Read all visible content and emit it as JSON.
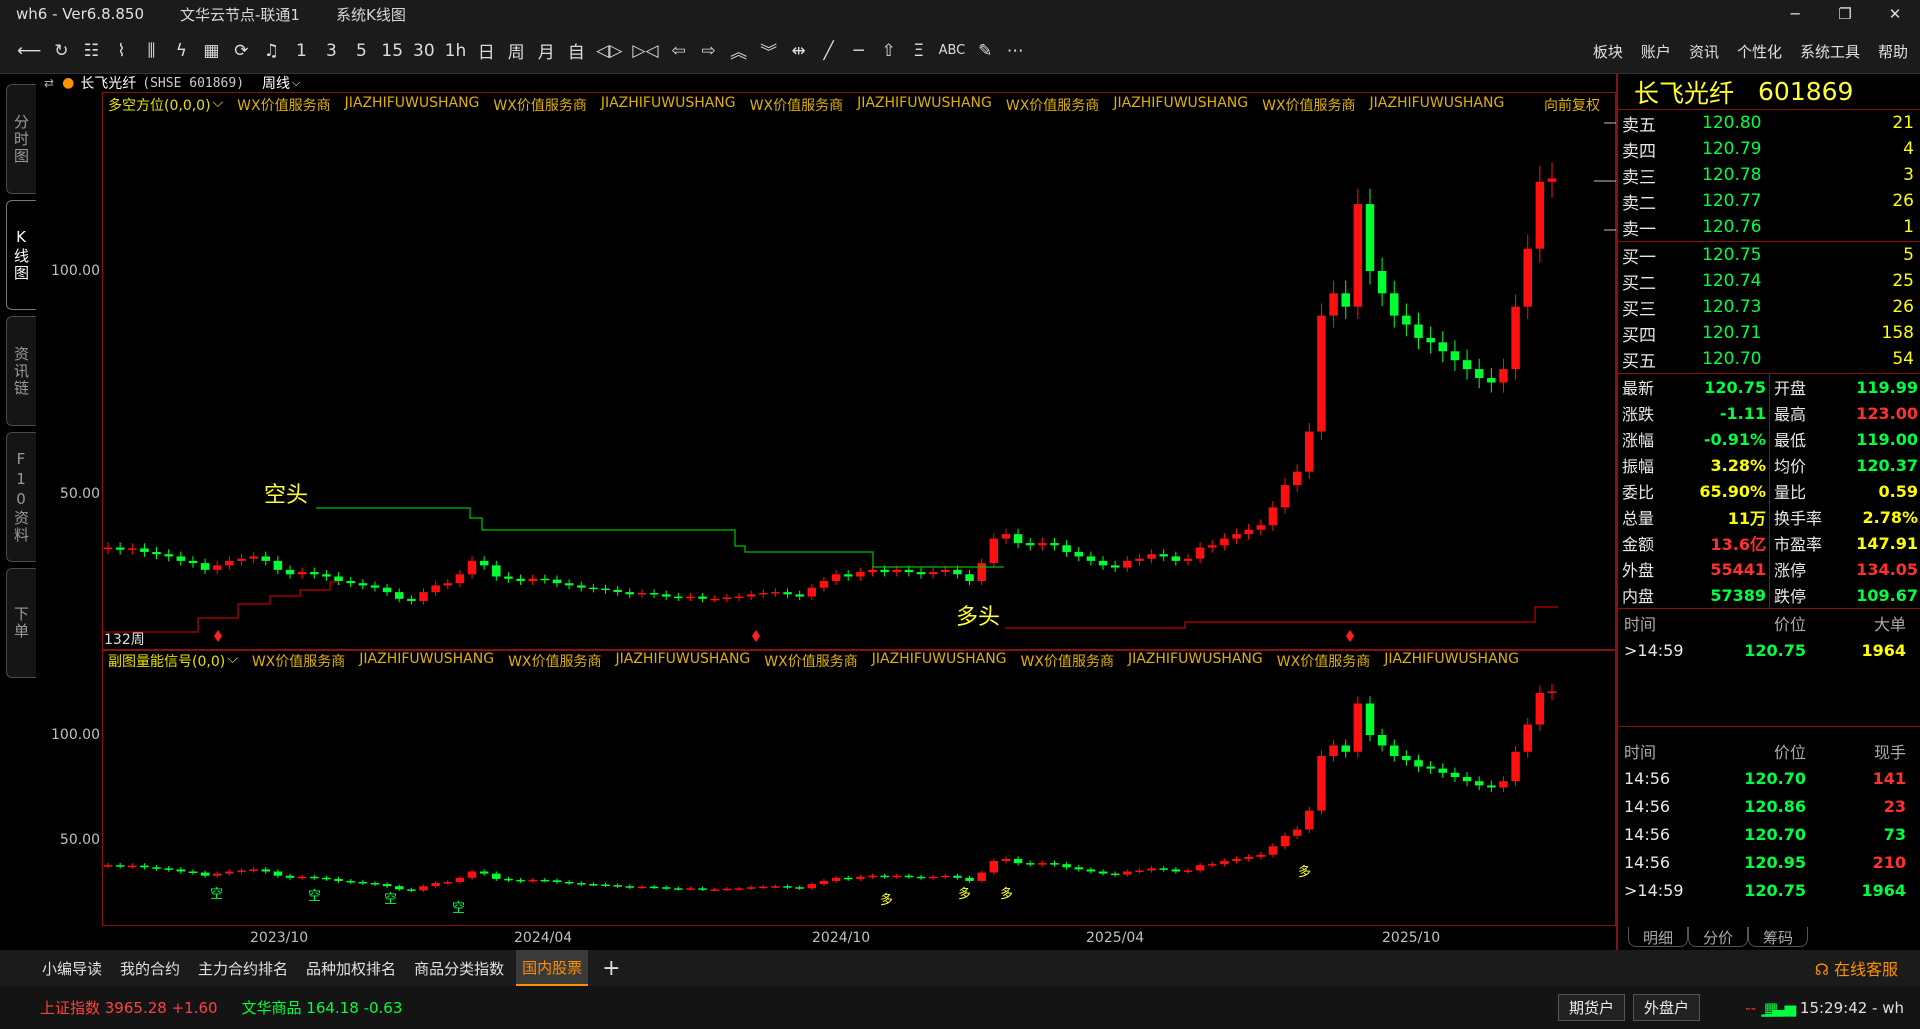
{
  "window": {
    "title": "wh6 - Ver6.8.850",
    "server": "文华云节点-联通1",
    "view": "系统K线图",
    "controls": [
      "─",
      "❐",
      "✕"
    ]
  },
  "toolbar": {
    "periods": [
      "1",
      "3",
      "5",
      "15",
      "30",
      "1h",
      "日",
      "周",
      "月",
      "自"
    ],
    "menus": [
      "板块",
      "账户",
      "资讯",
      "个性化",
      "系统工具",
      "帮助"
    ]
  },
  "left_tabs": [
    "分时图",
    "K线图",
    "资讯链",
    "F10资料",
    "下单"
  ],
  "stock": {
    "name": "长飞光纤",
    "market_code": "(SHSE 601869)",
    "period": "周线",
    "full_code": "601869"
  },
  "main_panel": {
    "indicator": "多空方位(0,0,0)",
    "watermark_a": "WX价值服务商",
    "watermark_b": "JIAZHIFUWUSHANG",
    "adjust": "向前复权",
    "ma_label": "132周",
    "bear_label": "空头",
    "bull_label": "多头",
    "y_ticks": [
      "100.00",
      "50.00"
    ]
  },
  "sub_panel": {
    "indicator": "副图量能信号(0,0)",
    "y_ticks": [
      "100.00",
      "50.00"
    ],
    "kong_label": "空",
    "duo_label": "多"
  },
  "x_axis": [
    "2023/10",
    "2024/04",
    "2024/10",
    "2025/04",
    "2025/10"
  ],
  "orderbook": {
    "asks": [
      {
        "label": "卖五",
        "price": "120.80",
        "vol": "21"
      },
      {
        "label": "卖四",
        "price": "120.79",
        "vol": "4"
      },
      {
        "label": "卖三",
        "price": "120.78",
        "vol": "3"
      },
      {
        "label": "卖二",
        "price": "120.77",
        "vol": "26"
      },
      {
        "label": "卖一",
        "price": "120.76",
        "vol": "1"
      }
    ],
    "bids": [
      {
        "label": "买一",
        "price": "120.75",
        "vol": "5"
      },
      {
        "label": "买二",
        "price": "120.74",
        "vol": "25"
      },
      {
        "label": "买三",
        "price": "120.73",
        "vol": "26"
      },
      {
        "label": "买四",
        "price": "120.71",
        "vol": "158"
      },
      {
        "label": "买五",
        "price": "120.70",
        "vol": "54"
      }
    ]
  },
  "stats": [
    {
      "k": "最新",
      "v": "120.75",
      "c": "#00ff40",
      "k2": "开盘",
      "v2": "119.99",
      "c2": "#00ff40"
    },
    {
      "k": "涨跌",
      "v": "-1.11",
      "c": "#00ff40",
      "k2": "最高",
      "v2": "123.00",
      "c2": "#ff3030"
    },
    {
      "k": "涨幅",
      "v": "-0.91%",
      "c": "#00ff40",
      "k2": "最低",
      "v2": "119.00",
      "c2": "#00ff40"
    },
    {
      "k": "振幅",
      "v": "3.28%",
      "c": "#ffff00",
      "k2": "均价",
      "v2": "120.37",
      "c2": "#00ff40"
    },
    {
      "k": "委比",
      "v": "65.90%",
      "c": "#ffff00",
      "k2": "量比",
      "v2": "0.59",
      "c2": "#ffff00"
    },
    {
      "k": "总量",
      "v": "11万",
      "c": "#ffff00",
      "k2": "换手率",
      "v2": "2.78%",
      "c2": "#ffff00"
    },
    {
      "k": "金额",
      "v": "13.6亿",
      "c": "#ff3030",
      "k2": "市盈率",
      "v2": "147.91",
      "c2": "#ffff00"
    },
    {
      "k": "外盘",
      "v": "55441",
      "c": "#ff3030",
      "k2": "涨停",
      "v2": "134.05",
      "c2": "#ff3030"
    },
    {
      "k": "内盘",
      "v": "57389",
      "c": "#00ff40",
      "k2": "跌停",
      "v2": "109.67",
      "c2": "#00ff40"
    }
  ],
  "bigorders": {
    "headers": [
      "时间",
      "价位",
      "大单"
    ],
    "rows": [
      {
        "t": ">14:59",
        "p": "120.75",
        "v": "1964",
        "c": "#ffff00"
      }
    ]
  },
  "ticks": {
    "headers": [
      "时间",
      "价位",
      "现手"
    ],
    "rows": [
      {
        "t": "14:56",
        "p": "120.70",
        "v": "141",
        "c": "#ff3030"
      },
      {
        "t": "14:56",
        "p": "120.86",
        "v": "23",
        "c": "#ff3030"
      },
      {
        "t": "14:56",
        "p": "120.70",
        "v": "73",
        "c": "#00ff40"
      },
      {
        "t": "14:56",
        "p": "120.95",
        "v": "210",
        "c": "#ff3030"
      },
      {
        "t": ">14:59",
        "p": "120.75",
        "v": "1964",
        "c": "#00ff40"
      }
    ]
  },
  "right_tabs": [
    "明细",
    "分价",
    "筹码"
  ],
  "bottom_tabs": [
    "小编导读",
    "我的合约",
    "主力合约排名",
    "品种加权排名",
    "商品分类指数",
    "国内股票"
  ],
  "online_service": "在线客服",
  "status": {
    "idx1": "上证指数 3965.28 +1.60",
    "idx2": "文华商品 164.18 -0.63",
    "btn1": "期货户",
    "btn2": "外盘户",
    "time": "15:29:42 - wh"
  },
  "chart_data": {
    "type": "candlestick",
    "title": "长飞光纤 601869 周线",
    "x_ticks": [
      "2023/10",
      "2024/04",
      "2024/10",
      "2025/04",
      "2025/10"
    ],
    "y_ticks": [
      100,
      50
    ],
    "close_series": [
      38,
      37.5,
      37.8,
      37,
      36.5,
      36,
      35,
      34.5,
      33,
      34,
      35,
      35.5,
      36,
      35,
      33,
      32,
      32.5,
      32,
      31.5,
      30.5,
      30,
      29.5,
      29,
      28,
      26.5,
      26,
      28,
      29.5,
      30,
      32,
      35,
      34,
      31.5,
      31,
      30.5,
      31,
      30.8,
      30,
      29.5,
      29,
      28.8,
      28.5,
      28,
      27.5,
      27.8,
      27.5,
      27,
      26.8,
      27,
      26.5,
      26.5,
      26.8,
      27,
      27.5,
      27.8,
      28,
      27.5,
      27,
      29,
      30.5,
      32,
      31.5,
      32.5,
      33,
      32.5,
      33,
      32.5,
      32,
      32.5,
      33,
      32,
      30.5,
      34.5,
      40,
      41,
      39,
      38.5,
      39,
      38.5,
      37,
      36,
      35,
      34,
      33.5,
      35,
      35.5,
      36.5,
      36,
      35,
      35.5,
      38,
      38.5,
      40,
      41,
      42,
      43,
      47,
      52,
      55,
      64,
      90,
      95,
      92,
      115,
      100,
      95,
      90,
      88,
      85,
      84,
      82,
      80,
      78,
      76,
      75,
      78,
      92,
      105,
      120,
      120.75
    ]
  }
}
